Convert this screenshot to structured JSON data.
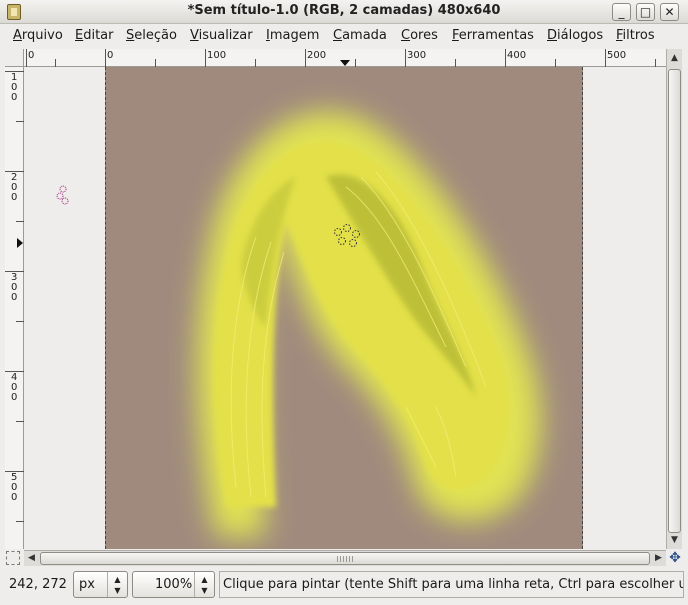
{
  "window": {
    "title": "*Sem título-1.0 (RGB, 2 camadas) 480x640",
    "minimize_glyph": "_",
    "maximize_glyph": "□",
    "close_glyph": "✕"
  },
  "menu": {
    "items": [
      "Arquivo",
      "Editar",
      "Seleção",
      "Visualizar",
      "Imagem",
      "Camada",
      "Cores",
      "Ferramentas",
      "Diálogos",
      "Filtros"
    ]
  },
  "ruler_h": {
    "labels": [
      "0",
      "0",
      "100",
      "200",
      "300",
      "400",
      "500"
    ]
  },
  "ruler_v": {
    "labels": [
      "100",
      "200",
      "300",
      "400",
      "500"
    ]
  },
  "canvas": {
    "background_color": "#a08a7e",
    "stroke_color": "#e3e04a",
    "stroke_shadow_color": "#9fa72c"
  },
  "statusbar": {
    "coords": "242, 272",
    "unit": "px",
    "zoom": "100%",
    "message": "Clique para pintar (tente Shift para uma linha reta, Ctrl para escolher u..."
  },
  "icons": {
    "app": "gimp-icon",
    "quickmask": "quick-mask-icon",
    "navigate": "navigate-icon"
  }
}
